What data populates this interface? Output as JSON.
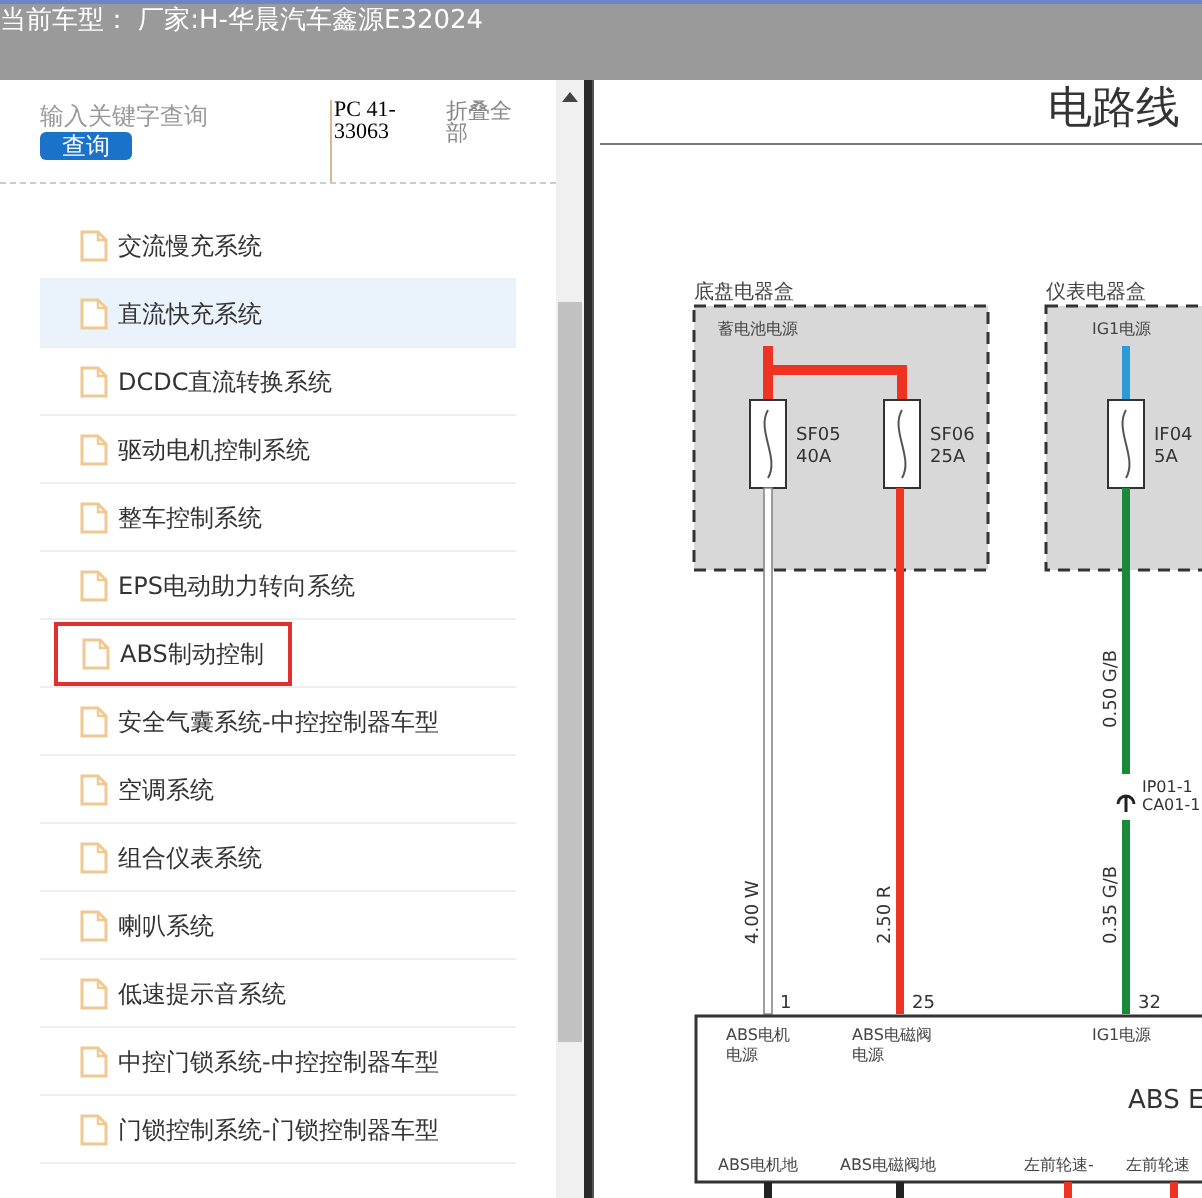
{
  "header": {
    "title": "当前车型： 厂家:H-华晨汽车鑫源E32024"
  },
  "search": {
    "placeholder": "输入关键字查询",
    "button": "查询",
    "code": "PC 41-33063",
    "collapse": "折叠全部"
  },
  "items": [
    {
      "label": "交流慢充系统",
      "selected": false,
      "outlined": false
    },
    {
      "label": "直流快充系统",
      "selected": true,
      "outlined": false
    },
    {
      "label": "DCDC直流转换系统",
      "selected": false,
      "outlined": false
    },
    {
      "label": "驱动电机控制系统",
      "selected": false,
      "outlined": false
    },
    {
      "label": "整车控制系统",
      "selected": false,
      "outlined": false
    },
    {
      "label": "EPS电动助力转向系统",
      "selected": false,
      "outlined": false
    },
    {
      "label": "ABS制动控制",
      "selected": false,
      "outlined": true
    },
    {
      "label": "安全气囊系统-中控控制器车型",
      "selected": false,
      "outlined": false
    },
    {
      "label": "空调系统",
      "selected": false,
      "outlined": false
    },
    {
      "label": "组合仪表系统",
      "selected": false,
      "outlined": false
    },
    {
      "label": "喇叭系统",
      "selected": false,
      "outlined": false
    },
    {
      "label": "低速提示音系统",
      "selected": false,
      "outlined": false
    },
    {
      "label": "中控门锁系统-中控控制器车型",
      "selected": false,
      "outlined": false
    },
    {
      "label": "门锁控制系统-门锁控制器车型",
      "selected": false,
      "outlined": false
    }
  ],
  "diagram": {
    "title": "电路线",
    "boxes": [
      {
        "label": "底盘电器盒",
        "source": "蓄电池电源"
      },
      {
        "label": "仪表电器盒",
        "source": "IG1电源"
      }
    ],
    "fuses": [
      {
        "name": "SF05",
        "rating": "40A"
      },
      {
        "name": "SF06",
        "rating": "25A"
      },
      {
        "name": "IF04",
        "rating": "5A"
      }
    ],
    "wires": [
      {
        "label": "4.00 W",
        "pin": "1",
        "color": "#ffffff"
      },
      {
        "label": "2.50 R",
        "pin": "25",
        "color": "#ee3322"
      },
      {
        "label": "0.35 G/B",
        "upper_label": "0.50 G/B",
        "pin": "32",
        "color": "#1a8a3a"
      }
    ],
    "connector": [
      "IP01-1",
      "CA01-1"
    ],
    "module": {
      "name": "ABS E",
      "top_labels": [
        [
          "ABS电机",
          "电源"
        ],
        [
          "ABS电磁阀",
          "电源"
        ],
        [
          "IG1电源"
        ]
      ],
      "bottom_labels": [
        "ABS电机地",
        "ABS电磁阀地",
        "左前轮速-",
        "左前轮速"
      ]
    }
  }
}
